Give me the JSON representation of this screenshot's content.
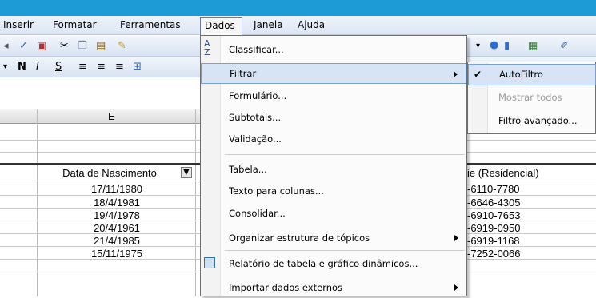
{
  "menubar": {
    "items": [
      "Inserir",
      "Formatar",
      "Ferramentas",
      "Dados",
      "Janela",
      "Ajuda"
    ]
  },
  "toolbar2": {
    "bold": "N",
    "italic": "I",
    "underline": "S"
  },
  "sheet": {
    "column_label": "E",
    "header_cell": "Data de Nascimento",
    "phone_header": "ie (Residencial)",
    "dates": [
      "17/11/1980",
      "18/4/1981",
      "19/4/1978",
      "20/4/1961",
      "21/4/1985",
      "15/11/1975"
    ],
    "phones": [
      "-6110-7780",
      "-6646-4305",
      "-6910-7653",
      "-6919-0950",
      "-6919-1168",
      "-7252-0066"
    ]
  },
  "dados_menu": {
    "items": [
      {
        "label": "Classificar...",
        "icon": "sort-az-icon"
      },
      {
        "label": "Filtrar",
        "submenu": true,
        "highlighted": true
      },
      {
        "label": "Formulário..."
      },
      {
        "label": "Subtotais..."
      },
      {
        "label": "Validação..."
      },
      {
        "label": "Tabela..."
      },
      {
        "label": "Texto para colunas..."
      },
      {
        "label": "Consolidar..."
      },
      {
        "label": "Organizar estrutura de tópicos",
        "submenu": true
      },
      {
        "label": "Relatório de tabela e gráfico dinâmicos...",
        "icon": "pivot-table-icon"
      },
      {
        "label": "Importar dados externos",
        "submenu": true
      }
    ]
  },
  "filtrar_submenu": {
    "items": [
      {
        "label": "AutoFiltro",
        "checked": true,
        "highlighted": true
      },
      {
        "label": "Mostrar todos",
        "disabled": true
      },
      {
        "label": "Filtro avançado..."
      }
    ]
  }
}
